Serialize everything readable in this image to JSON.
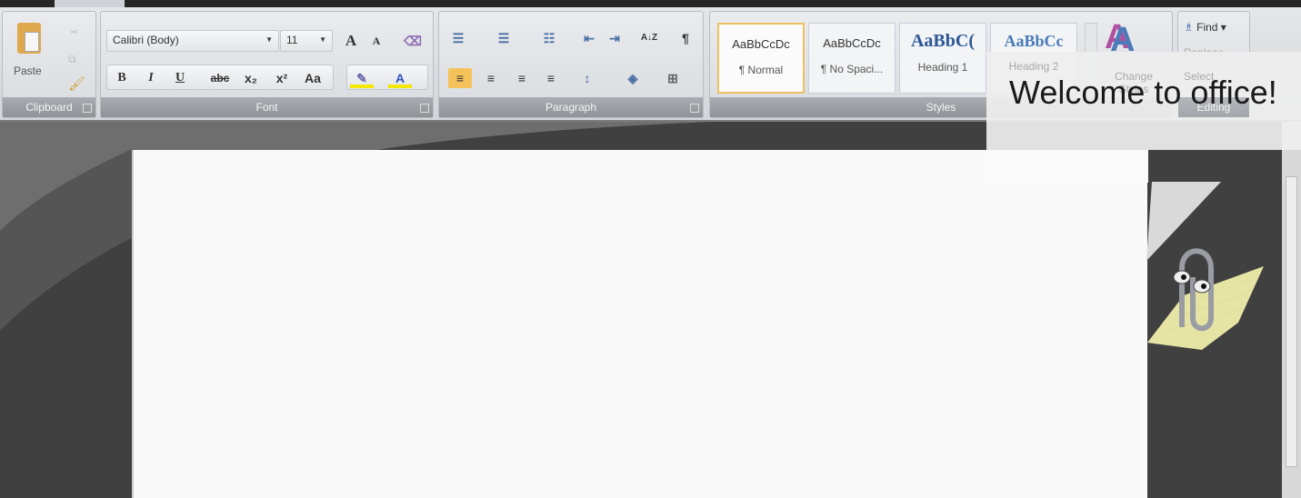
{
  "ribbon": {
    "clipboard": {
      "label": "Clipboard",
      "paste": "Paste"
    },
    "font": {
      "label": "Font",
      "font_name": "Calibri (Body)",
      "font_size": "11",
      "bold": "B",
      "italic": "I",
      "underline": "U",
      "strike": "abc",
      "subscript": "x₂",
      "superscript": "x²",
      "change_case": "Aa",
      "grow": "A",
      "shrink": "A",
      "font_color": "A"
    },
    "paragraph": {
      "label": "Paragraph",
      "sort": "A↓Z",
      "pilcrow": "¶"
    },
    "styles": {
      "label": "Styles",
      "items": [
        {
          "preview": "AaBbCcDc",
          "name": "¶ Normal"
        },
        {
          "preview": "AaBbCcDc",
          "name": "¶ No Spaci..."
        },
        {
          "preview": "AaBbC(",
          "name": "Heading 1"
        },
        {
          "preview": "AaBbCc",
          "name": "Heading 2"
        }
      ],
      "change": "Change Styles"
    },
    "editing": {
      "label": "Editing",
      "find": "Find",
      "replace": "Replace",
      "select": "Select"
    }
  },
  "assistant": {
    "message": "Welcome to office!"
  },
  "colors": {
    "accent": "#f0c060",
    "heading": "#2b5797"
  }
}
